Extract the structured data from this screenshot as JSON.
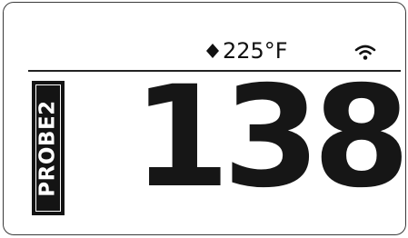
{
  "status_bar": {
    "setpoint": "225°F",
    "setpoint_icon": "diamond-icon",
    "wifi_icon": "wifi-icon"
  },
  "probe": {
    "label": "PROBE2",
    "temperature": "138"
  },
  "colors": {
    "foreground": "#141414",
    "background": "#ffffff"
  }
}
